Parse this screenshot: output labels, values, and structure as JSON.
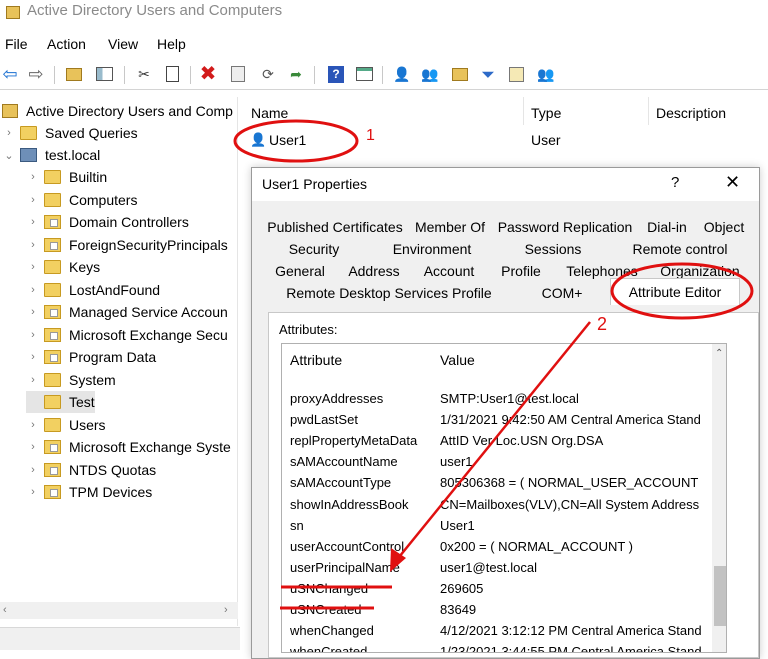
{
  "window": {
    "title": "Active Directory Users and Computers"
  },
  "menu": [
    "File",
    "Action",
    "View",
    "Help"
  ],
  "toolbar_icons": [
    "back-icon",
    "forward-icon",
    "up-folder-icon",
    "show-console-tree-icon",
    "cut-icon",
    "copy-icon",
    "delete-icon",
    "properties-icon",
    "refresh-icon",
    "export-list-icon",
    "help-icon",
    "console-icon",
    "new-user-icon",
    "new-group-icon",
    "new-ou-icon",
    "filter-icon",
    "find-icon",
    "add-to-group-icon"
  ],
  "tree": {
    "root": "Active Directory Users and Comp",
    "saved_queries": "Saved Queries",
    "domain": "test.local",
    "children": [
      "Builtin",
      "Computers",
      "Domain Controllers",
      "ForeignSecurityPrincipals",
      "Keys",
      "LostAndFound",
      "Managed Service Accoun",
      "Microsoft Exchange Secu",
      "Program Data",
      "System",
      "Test",
      "Users",
      "Microsoft Exchange Syste",
      "NTDS Quotas",
      "TPM Devices"
    ],
    "selected": "Test"
  },
  "list": {
    "columns": [
      "Name",
      "Type",
      "Description"
    ],
    "rows": [
      {
        "name": "User1",
        "type": "User"
      }
    ]
  },
  "dialog": {
    "title": "User1 Properties",
    "help": "?",
    "close": "✕",
    "tabs_row1": [
      "Published Certificates",
      "Member Of",
      "Password Replication",
      "Dial-in",
      "Object"
    ],
    "tabs_row2": [
      "Security",
      "Environment",
      "Sessions",
      "Remote control"
    ],
    "tabs_row3": [
      "General",
      "Address",
      "Account",
      "Profile",
      "Telephones",
      "Organization"
    ],
    "tabs_row4": [
      "Remote Desktop Services Profile",
      "COM+",
      "Attribute Editor"
    ],
    "active_tab": "Attribute Editor",
    "attributes_label": "Attributes:",
    "grid_headers": [
      "Attribute",
      "Value"
    ],
    "rows": [
      {
        "attr": "proxyAddresses",
        "value": "SMTP:User1@test.local"
      },
      {
        "attr": "pwdLastSet",
        "value": "1/31/2021 9:42:50 AM Central America Stand"
      },
      {
        "attr": "replPropertyMetaData",
        "value": "AttID  Ver   Loc.USN          Org.DSA"
      },
      {
        "attr": "sAMAccountName",
        "value": "user1"
      },
      {
        "attr": "sAMAccountType",
        "value": "805306368 = ( NORMAL_USER_ACCOUNT"
      },
      {
        "attr": "showInAddressBook",
        "value": "CN=Mailboxes(VLV),CN=All System Address"
      },
      {
        "attr": "sn",
        "value": "User1"
      },
      {
        "attr": "userAccountControl",
        "value": "0x200 = ( NORMAL_ACCOUNT )"
      },
      {
        "attr": "userPrincipalName",
        "value": "user1@test.local"
      },
      {
        "attr": "uSNChanged",
        "value": "269605"
      },
      {
        "attr": "uSNCreated",
        "value": "83649"
      },
      {
        "attr": "whenChanged",
        "value": "4/12/2021 3:12:12 PM Central America Stand"
      },
      {
        "attr": "whenCreated",
        "value": "1/23/2021 3:44:55 PM Central America Stand"
      }
    ]
  },
  "annotations": {
    "callout1": "1",
    "callout2": "2",
    "color": "#e01010"
  }
}
